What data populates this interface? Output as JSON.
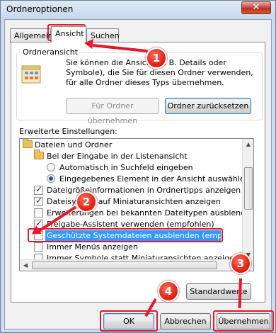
{
  "window": {
    "title": "Ordneroptionen",
    "close_label": "✕"
  },
  "tabs": [
    {
      "label": "Allgemein"
    },
    {
      "label": "Ansicht"
    },
    {
      "label": "Suchen"
    }
  ],
  "folder_view": {
    "group_label": "Ordneransicht",
    "description": "Sie können die Ansicht (z. B. Details oder Symbole), die Sie für diesen Ordner verwenden, für alle Ordner dieses Typs übernehmen.",
    "apply_button": "Für Ordner übernehmen",
    "reset_button": "Ordner zurücksetzen"
  },
  "advanced": {
    "label": "Erweiterte Einstellungen:",
    "items": [
      {
        "text": "Dateien und Ordner",
        "type": "folder"
      },
      {
        "text": "Bei der Eingabe in der Listenansicht",
        "type": "folder"
      },
      {
        "text": "Automatisch in Suchfeld eingeben",
        "type": "radio",
        "checked": false
      },
      {
        "text": "Eingegebenes Element in der Ansicht auswählen",
        "type": "radio",
        "checked": true
      },
      {
        "text": "Dateigrößeinformationen in Ordnertipps anzeigen",
        "type": "checkbox",
        "checked": true
      },
      {
        "text": "Dateisymbol auf Miniaturansichten anzeigen",
        "type": "checkbox",
        "checked": true
      },
      {
        "text": "Erweiterungen bei bekannten Dateitypen ausblenden",
        "type": "checkbox",
        "checked": false
      },
      {
        "text": "Freigabe-Assistent verwenden (empfohlen)",
        "type": "checkbox",
        "checked": true
      },
      {
        "text": "Geschützte Systemdateien ausblenden (empfohlen)",
        "type": "checkbox",
        "checked": false
      },
      {
        "text": "Immer Menüs anzeigen",
        "type": "checkbox",
        "checked": false
      },
      {
        "text": "Immer Symbole statt Miniaturansichten anzeigen",
        "type": "checkbox",
        "checked": false
      }
    ],
    "defaults_button": "Standardwerte"
  },
  "footer": {
    "ok": "OK",
    "cancel": "Abbrechen",
    "apply": "Übernehmen"
  },
  "annotations": [
    "1",
    "2",
    "3",
    "4"
  ],
  "colors": {
    "annotation_red": "#e8172c",
    "selection_blue": "#3399ff"
  }
}
